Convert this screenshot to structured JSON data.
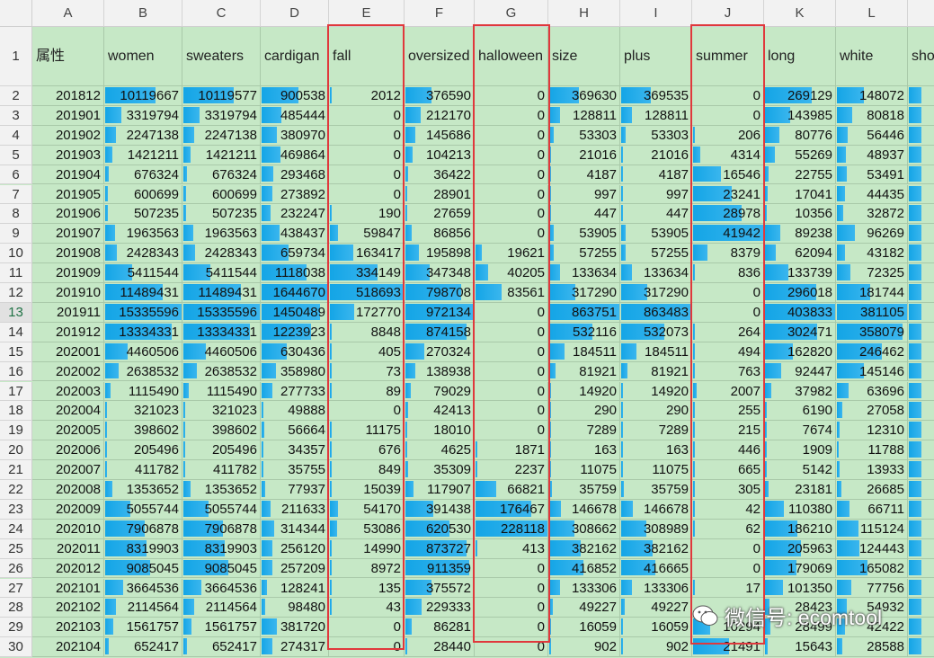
{
  "columns": [
    "A",
    "B",
    "C",
    "D",
    "E",
    "F",
    "G",
    "H",
    "I",
    "J",
    "K",
    "L"
  ],
  "headers": [
    "属性",
    "women",
    "sweaters",
    "cardigan",
    "fall",
    "oversized",
    "halloween",
    "size",
    "plus",
    "summer",
    "long",
    "white",
    "sho"
  ],
  "selected_row": "13",
  "watermark": "微信号: ecomtool",
  "colors": {
    "bar": "#1aa7e8",
    "cell_bg": "#c6e8c6",
    "highlight_box": "#e0383c"
  },
  "col_max": [
    15335596,
    15335596,
    1644670,
    518693,
    972134,
    228118,
    863751,
    863483,
    41942,
    403833,
    381105
  ],
  "rows": [
    {
      "n": "2",
      "vals": [
        "201812",
        "10119667",
        "10119577",
        "900538",
        "2012",
        "376590",
        "0",
        "369630",
        "369535",
        "0",
        "269129",
        "148072"
      ]
    },
    {
      "n": "3",
      "vals": [
        "201901",
        "3319794",
        "3319794",
        "485444",
        "0",
        "212170",
        "0",
        "128811",
        "128811",
        "0",
        "143985",
        "80818"
      ]
    },
    {
      "n": "4",
      "vals": [
        "201902",
        "2247138",
        "2247138",
        "380970",
        "0",
        "145686",
        "0",
        "53303",
        "53303",
        "206",
        "80776",
        "56446"
      ]
    },
    {
      "n": "5",
      "vals": [
        "201903",
        "1421211",
        "1421211",
        "469864",
        "0",
        "104213",
        "0",
        "21016",
        "21016",
        "4314",
        "55269",
        "48937"
      ]
    },
    {
      "n": "6",
      "vals": [
        "201904",
        "676324",
        "676324",
        "293468",
        "0",
        "36422",
        "0",
        "4187",
        "4187",
        "16546",
        "22755",
        "53491"
      ]
    },
    {
      "n": "7",
      "vals": [
        "201905",
        "600699",
        "600699",
        "273892",
        "0",
        "28901",
        "0",
        "997",
        "997",
        "23241",
        "17041",
        "44435"
      ]
    },
    {
      "n": "8",
      "vals": [
        "201906",
        "507235",
        "507235",
        "232247",
        "190",
        "27659",
        "0",
        "447",
        "447",
        "28978",
        "10356",
        "32872"
      ]
    },
    {
      "n": "9",
      "vals": [
        "201907",
        "1963563",
        "1963563",
        "438437",
        "59847",
        "86856",
        "0",
        "53905",
        "53905",
        "41942",
        "89238",
        "96269"
      ]
    },
    {
      "n": "10",
      "vals": [
        "201908",
        "2428343",
        "2428343",
        "659734",
        "163417",
        "195898",
        "19621",
        "57255",
        "57255",
        "8379",
        "62094",
        "43182"
      ]
    },
    {
      "n": "11",
      "vals": [
        "201909",
        "5411544",
        "5411544",
        "1118038",
        "334149",
        "347348",
        "40205",
        "133634",
        "133634",
        "836",
        "133739",
        "72325"
      ]
    },
    {
      "n": "12",
      "vals": [
        "201910",
        "11489431",
        "11489431",
        "1644670",
        "518693",
        "798708",
        "83561",
        "317290",
        "317290",
        "0",
        "296018",
        "181744"
      ]
    },
    {
      "n": "13",
      "vals": [
        "201911",
        "15335596",
        "15335596",
        "1450489",
        "172770",
        "972134",
        "0",
        "863751",
        "863483",
        "0",
        "403833",
        "381105"
      ]
    },
    {
      "n": "14",
      "vals": [
        "201912",
        "13334331",
        "13334331",
        "1223923",
        "8848",
        "874158",
        "0",
        "532116",
        "532073",
        "264",
        "302471",
        "358079"
      ]
    },
    {
      "n": "15",
      "vals": [
        "202001",
        "4460506",
        "4460506",
        "630436",
        "405",
        "270324",
        "0",
        "184511",
        "184511",
        "494",
        "162820",
        "246462"
      ]
    },
    {
      "n": "16",
      "vals": [
        "202002",
        "2638532",
        "2638532",
        "358980",
        "73",
        "138938",
        "0",
        "81921",
        "81921",
        "763",
        "92447",
        "145146"
      ]
    },
    {
      "n": "17",
      "vals": [
        "202003",
        "1115490",
        "1115490",
        "277733",
        "89",
        "79029",
        "0",
        "14920",
        "14920",
        "2007",
        "37982",
        "63696"
      ]
    },
    {
      "n": "18",
      "vals": [
        "202004",
        "321023",
        "321023",
        "49888",
        "0",
        "42413",
        "0",
        "290",
        "290",
        "255",
        "6190",
        "27058"
      ]
    },
    {
      "n": "19",
      "vals": [
        "202005",
        "398602",
        "398602",
        "56664",
        "11175",
        "18010",
        "0",
        "7289",
        "7289",
        "215",
        "7674",
        "12310"
      ]
    },
    {
      "n": "20",
      "vals": [
        "202006",
        "205496",
        "205496",
        "34357",
        "676",
        "4625",
        "1871",
        "163",
        "163",
        "446",
        "1909",
        "11788"
      ]
    },
    {
      "n": "21",
      "vals": [
        "202007",
        "411782",
        "411782",
        "35755",
        "849",
        "35309",
        "2237",
        "11075",
        "11075",
        "665",
        "5142",
        "13933"
      ]
    },
    {
      "n": "22",
      "vals": [
        "202008",
        "1353652",
        "1353652",
        "77937",
        "15039",
        "117907",
        "66821",
        "35759",
        "35759",
        "305",
        "23181",
        "26685"
      ]
    },
    {
      "n": "23",
      "vals": [
        "202009",
        "5055744",
        "5055744",
        "211633",
        "54170",
        "391438",
        "176467",
        "146678",
        "146678",
        "42",
        "110380",
        "66711"
      ]
    },
    {
      "n": "24",
      "vals": [
        "202010",
        "7906878",
        "7906878",
        "314344",
        "53086",
        "620530",
        "228118",
        "308662",
        "308989",
        "62",
        "186210",
        "115124"
      ]
    },
    {
      "n": "25",
      "vals": [
        "202011",
        "8319903",
        "8319903",
        "256120",
        "14990",
        "873727",
        "413",
        "382162",
        "382162",
        "0",
        "205963",
        "124443"
      ]
    },
    {
      "n": "26",
      "vals": [
        "202012",
        "9085045",
        "9085045",
        "257209",
        "8972",
        "911359",
        "0",
        "416852",
        "416665",
        "0",
        "179069",
        "165082"
      ]
    },
    {
      "n": "27",
      "vals": [
        "202101",
        "3664536",
        "3664536",
        "128241",
        "135",
        "375572",
        "0",
        "133306",
        "133306",
        "17",
        "101350",
        "77756"
      ]
    },
    {
      "n": "28",
      "vals": [
        "202102",
        "2114564",
        "2114564",
        "98480",
        "43",
        "229333",
        "0",
        "49227",
        "49227",
        "",
        "28423",
        "54932"
      ]
    },
    {
      "n": "29",
      "vals": [
        "202103",
        "1561757",
        "1561757",
        "381720",
        "0",
        "86281",
        "0",
        "16059",
        "16059",
        "10294",
        "28499",
        "42422"
      ]
    },
    {
      "n": "30",
      "vals": [
        "202104",
        "652417",
        "652417",
        "274317",
        "0",
        "28440",
        "0",
        "902",
        "902",
        "21491",
        "15643",
        "28588"
      ]
    }
  ]
}
